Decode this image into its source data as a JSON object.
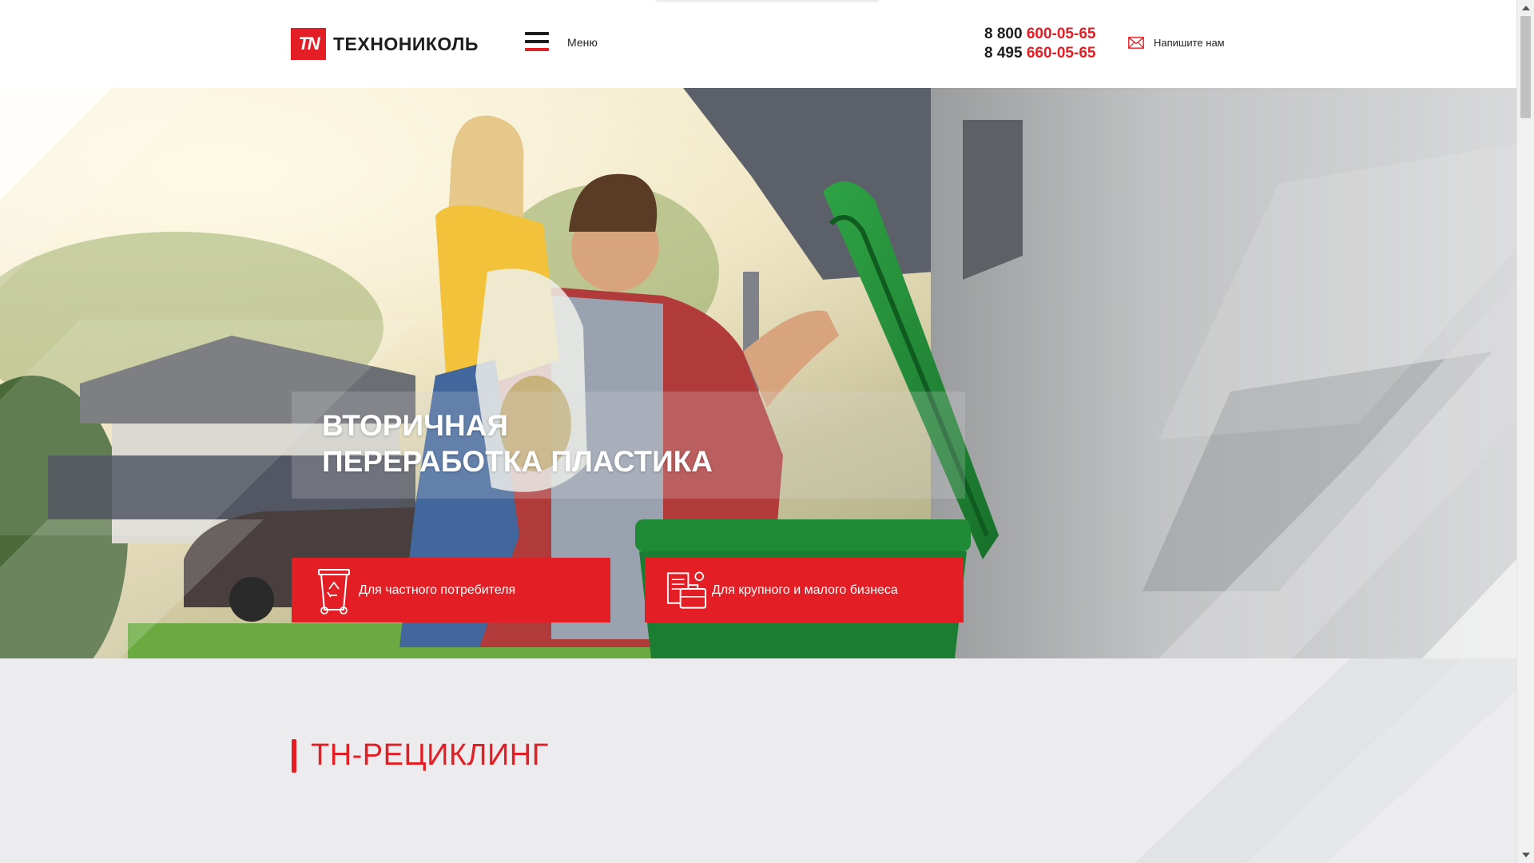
{
  "brand": {
    "logo_mark": "TN",
    "name": "ТЕХНОНИКОЛЬ",
    "accent_color": "#e31e24"
  },
  "header": {
    "menu_label": "Меню",
    "phones": [
      {
        "prefix": "8 800",
        "number": "600-05-65"
      },
      {
        "prefix": "8 495",
        "number": "660-05-65"
      }
    ],
    "write_label": "Напишите нам"
  },
  "hero": {
    "title_line1": "ВТОРИЧНАЯ",
    "title_line2": "ПЕРЕРАБОТКА ПЛАСТИКА",
    "cta": [
      {
        "label": "Для частного потребителя",
        "icon": "recycle-bin-icon"
      },
      {
        "label": "Для крупного и малого бизнеса",
        "icon": "briefcase-documents-icon"
      }
    ]
  },
  "section": {
    "title": "ТН-РЕЦИКЛИНГ"
  }
}
